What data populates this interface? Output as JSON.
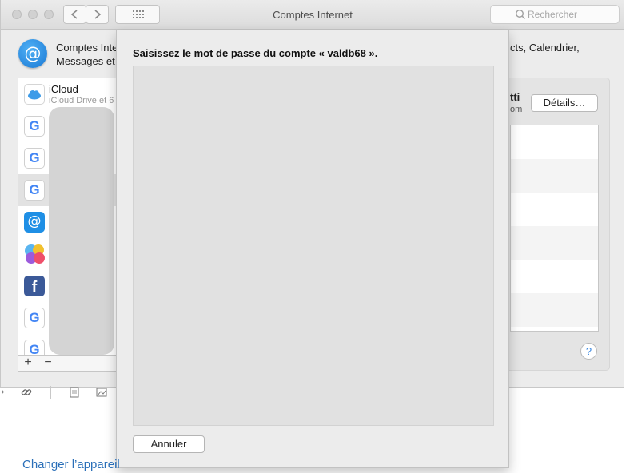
{
  "window": {
    "title": "Comptes Internet",
    "search_placeholder": "Rechercher",
    "header_text_line1": "Comptes Inte",
    "header_text_line2": "Messages et",
    "header_text_right": "cts, Calendrier,"
  },
  "accounts": {
    "icloud_name": "iCloud",
    "icloud_sub": "iCloud Drive et 6",
    "google_letter": "G",
    "facebook_letter": "f",
    "at_symbol": "@",
    "add_label": "+",
    "remove_label": "−"
  },
  "right_panel": {
    "name_fragment": "tti",
    "email_fragment": "om",
    "details_label": "Détails…",
    "help_label": "?"
  },
  "sheet": {
    "title": "Saisissez le mot de passe du compte « valdb68 ».",
    "cancel_label": "Annuler"
  },
  "bottom": {
    "link_text": "Changer l’appareil"
  },
  "colors": {
    "accent": "#2a6fb8",
    "mail_blue": "#1f8fe5",
    "facebook": "#3b5998"
  },
  "icons": [
    "icloud-icon",
    "google-icon",
    "mail-at-icon",
    "game-center-icon",
    "facebook-icon",
    "help-icon",
    "search-icon",
    "grid-icon"
  ]
}
